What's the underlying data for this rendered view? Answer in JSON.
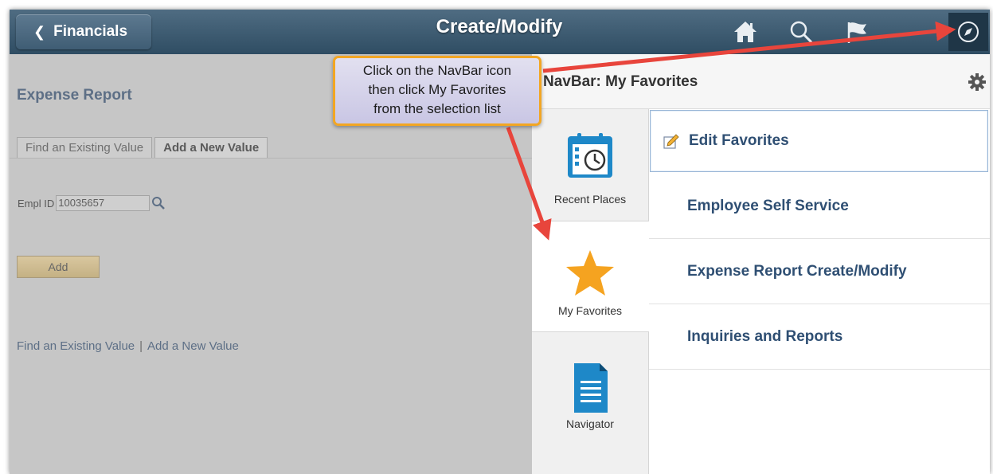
{
  "header": {
    "back_label": "Financials",
    "title": "Create/Modify",
    "icons": [
      "home-icon",
      "search-icon",
      "flag-icon",
      "navbar-compass-icon"
    ]
  },
  "page": {
    "title": "Expense Report",
    "tabs": [
      "Find an Existing Value",
      "Add a New Value"
    ],
    "empl_id_label": "Empl ID",
    "empl_id_value": "10035657",
    "add_button": "Add",
    "bottom_links": [
      "Find an Existing Value",
      "Add a New Value"
    ],
    "link_separator": "|"
  },
  "navbar": {
    "title": "NavBar: My Favorites",
    "tiles": [
      {
        "label": "Recent Places",
        "icon": "calendar-clock-icon"
      },
      {
        "label": "My Favorites",
        "icon": "star-icon",
        "selected": true
      },
      {
        "label": "Navigator",
        "icon": "document-icon"
      }
    ],
    "favorites": [
      "Edit Favorites",
      "Employee Self Service",
      "Expense Report Create/Modify",
      "Inquiries and Reports"
    ]
  },
  "callout": {
    "lines": [
      "Click on the NavBar icon",
      "then click My Favorites",
      "from the selection list"
    ],
    "border_color": "#f2a623",
    "arrow_color": "#e8453c"
  },
  "colors": {
    "header": "#2f4d63",
    "link_blue": "#2f4f73",
    "star": "#f5a320"
  }
}
